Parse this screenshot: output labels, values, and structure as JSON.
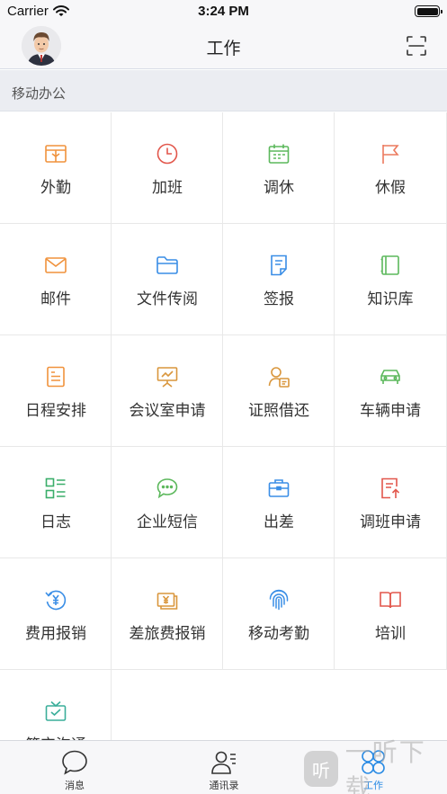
{
  "status_bar": {
    "carrier": "Carrier",
    "time": "3:24 PM"
  },
  "header": {
    "title": "工作",
    "avatar_icon": "user-avatar-icon",
    "scan_icon": "scan-icon"
  },
  "section": {
    "title": "移动办公"
  },
  "apps": [
    {
      "label": "外勤",
      "icon": "field-work-icon",
      "color": "#f0923c"
    },
    {
      "label": "加班",
      "icon": "clock-icon",
      "color": "#e2574c"
    },
    {
      "label": "调休",
      "icon": "calendar-icon",
      "color": "#5cb85c"
    },
    {
      "label": "休假",
      "icon": "flag-icon",
      "color": "#ec7a5e"
    },
    {
      "label": "邮件",
      "icon": "mail-icon",
      "color": "#f0923c"
    },
    {
      "label": "文件传阅",
      "icon": "folder-icon",
      "color": "#3a8ee6"
    },
    {
      "label": "签报",
      "icon": "document-sign-icon",
      "color": "#3a8ee6"
    },
    {
      "label": "知识库",
      "icon": "book-icon",
      "color": "#5cb85c"
    },
    {
      "label": "日程安排",
      "icon": "schedule-icon",
      "color": "#f0923c"
    },
    {
      "label": "会议室申请",
      "icon": "meeting-board-icon",
      "color": "#d9963c"
    },
    {
      "label": "证照借还",
      "icon": "license-icon",
      "color": "#d9963c"
    },
    {
      "label": "车辆申请",
      "icon": "car-icon",
      "color": "#5cb85c"
    },
    {
      "label": "日志",
      "icon": "log-list-icon",
      "color": "#3aae6a"
    },
    {
      "label": "企业短信",
      "icon": "message-bubble-icon",
      "color": "#5cb85c"
    },
    {
      "label": "出差",
      "icon": "briefcase-icon",
      "color": "#3a8ee6"
    },
    {
      "label": "调班申请",
      "icon": "shift-request-icon",
      "color": "#e2574c"
    },
    {
      "label": "费用报销",
      "icon": "yen-refund-icon",
      "color": "#3a8ee6"
    },
    {
      "label": "差旅费报销",
      "icon": "yen-bill-icon",
      "color": "#d9963c"
    },
    {
      "label": "移动考勤",
      "icon": "fingerprint-icon",
      "color": "#3a8ee6"
    },
    {
      "label": "培训",
      "icon": "open-book-icon",
      "color": "#e2574c"
    },
    {
      "label": "简宝沟通",
      "icon": "chat-gift-icon",
      "color": "#3aae9a"
    }
  ],
  "tabbar": [
    {
      "label": "消息",
      "icon": "message-tab-icon",
      "active": false
    },
    {
      "label": "通讯录",
      "icon": "contacts-tab-icon",
      "active": false
    },
    {
      "label": "工作",
      "icon": "work-tab-icon",
      "active": true
    }
  ],
  "watermark": {
    "badge": "听",
    "text": "一听下载"
  },
  "colors": {
    "accent": "#2a8be4",
    "nav_bg": "#f7f7f9",
    "section_bg": "#ebedf2"
  }
}
